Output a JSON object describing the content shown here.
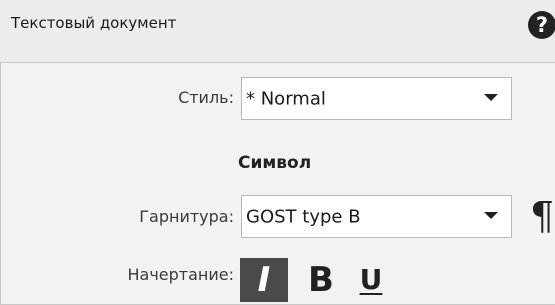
{
  "header": {
    "title": "Текстовый документ",
    "help_icon": "help-icon"
  },
  "style_row": {
    "label": "Стиль:",
    "value": "* Normal"
  },
  "section": {
    "title": "Символ"
  },
  "font_row": {
    "label": "Гарнитура:",
    "value": "GOST type B",
    "paragraph_symbol": "¶"
  },
  "format_row": {
    "label": "Начертание:",
    "italic": "I",
    "bold": "B",
    "underline": "U",
    "italic_active": true
  }
}
